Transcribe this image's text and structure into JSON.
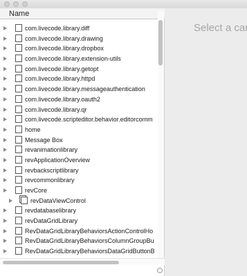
{
  "header": {
    "column_name": "Name"
  },
  "placeholder": "Select a car",
  "rows": [
    {
      "label": "com.livecode.library.diff",
      "indent": 0,
      "type": "page"
    },
    {
      "label": "com.livecode.library.drawing",
      "indent": 0,
      "type": "page"
    },
    {
      "label": "com.livecode.library.dropbox",
      "indent": 0,
      "type": "page"
    },
    {
      "label": "com.livecode.library.extension-utils",
      "indent": 0,
      "type": "page"
    },
    {
      "label": "com.livecode.library.getopt",
      "indent": 0,
      "type": "page"
    },
    {
      "label": "com.livecode.library.httpd",
      "indent": 0,
      "type": "page"
    },
    {
      "label": "com.livecode.library.messageauthentication",
      "indent": 0,
      "type": "page"
    },
    {
      "label": "com.livecode.library.oauth2",
      "indent": 0,
      "type": "page"
    },
    {
      "label": "com.livecode.library.qr",
      "indent": 0,
      "type": "page"
    },
    {
      "label": "com.livecode.scripteditor.behavior.editorcomm",
      "indent": 0,
      "type": "page"
    },
    {
      "label": "home",
      "indent": 0,
      "type": "page"
    },
    {
      "label": "Message Box",
      "indent": 0,
      "type": "page"
    },
    {
      "label": "revanimationlibrary",
      "indent": 0,
      "type": "page"
    },
    {
      "label": "revApplicationOverview",
      "indent": 0,
      "type": "page"
    },
    {
      "label": "revbackscriptlibrary",
      "indent": 0,
      "type": "page"
    },
    {
      "label": "revcommonlibrary",
      "indent": 0,
      "type": "page"
    },
    {
      "label": "revCore",
      "indent": 0,
      "type": "page"
    },
    {
      "label": "revDataViewControl",
      "indent": 1,
      "type": "stack"
    },
    {
      "label": "revdatabaselibrary",
      "indent": 0,
      "type": "page"
    },
    {
      "label": "revDataGridLibrary",
      "indent": 0,
      "type": "page"
    },
    {
      "label": "RevDataGridLibraryBehaviorsActionControlHo",
      "indent": 0,
      "type": "page"
    },
    {
      "label": "RevDataGridLibraryBehaviorsColumnGroupBu",
      "indent": 0,
      "type": "page"
    },
    {
      "label": "RevDataGridLibraryBehaviorsDataGridButtonB",
      "indent": 0,
      "type": "page"
    }
  ]
}
